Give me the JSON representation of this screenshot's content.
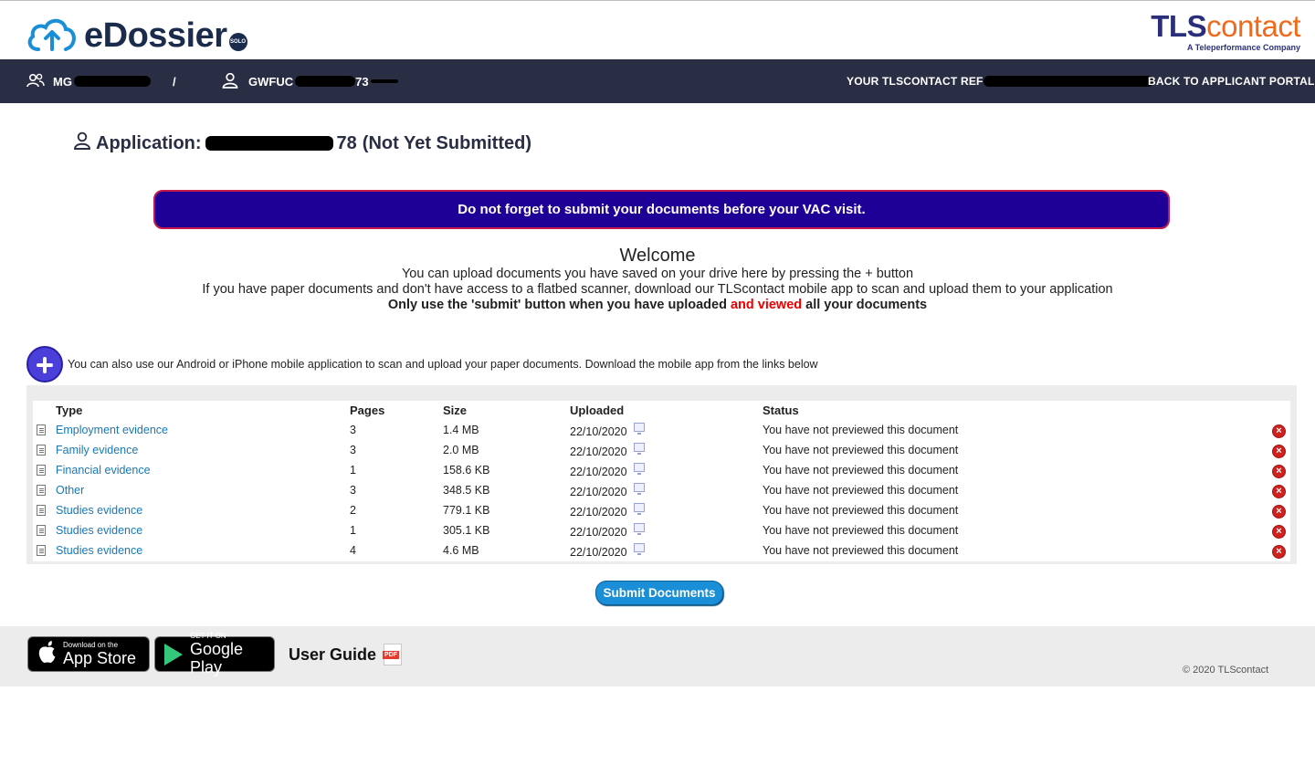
{
  "header": {
    "brand": "eDossier",
    "brand_badge": "SOLO",
    "partner_logo_main_a": "TLS",
    "partner_logo_main_b": "contact",
    "partner_logo_sub": "A Teleperformance Company"
  },
  "navbar": {
    "group_user_prefix": "MG",
    "separator": "/",
    "applicant_prefix": "GWFUC",
    "applicant_suffix": "73",
    "reference_prefix": "YOUR TLSCONTACT REF",
    "back_link": "BACK TO APPLICANT PORTAL"
  },
  "application": {
    "label": "Application:",
    "id_suffix": "78",
    "status": "(Not Yet Submitted)"
  },
  "banner": {
    "text": "Do not forget to submit your documents before your VAC visit."
  },
  "welcome": {
    "title": "Welcome",
    "line1": "You can upload documents you have saved on your drive here by pressing the + button",
    "line2": "If you have paper documents and don't have access to a flatbed scanner, download our TLScontact mobile app to scan and upload them to your application",
    "line3_a": "Only use the 'submit' button when you have uploaded ",
    "line3_red": "and viewed",
    "line3_b": " all your documents"
  },
  "add_section": {
    "text": "You can also use our Android or iPhone mobile application to scan and upload your paper documents. Download the mobile app from the links below"
  },
  "table": {
    "headers": {
      "type": "Type",
      "pages": "Pages",
      "size": "Size",
      "uploaded": "Uploaded",
      "status": "Status"
    },
    "rows": [
      {
        "type": "Employment evidence",
        "pages": "3",
        "size": "1.4 MB",
        "uploaded": "22/10/2020",
        "status": "You have not previewed this document"
      },
      {
        "type": "Family evidence",
        "pages": "3",
        "size": "2.0 MB",
        "uploaded": "22/10/2020",
        "status": "You have not previewed this document"
      },
      {
        "type": "Financial evidence",
        "pages": "1",
        "size": "158.6 KB",
        "uploaded": "22/10/2020",
        "status": "You have not previewed this document"
      },
      {
        "type": "Other",
        "pages": "3",
        "size": "348.5 KB",
        "uploaded": "22/10/2020",
        "status": "You have not previewed this document"
      },
      {
        "type": "Studies evidence",
        "pages": "2",
        "size": "779.1 KB",
        "uploaded": "22/10/2020",
        "status": "You have not previewed this document"
      },
      {
        "type": "Studies evidence",
        "pages": "1",
        "size": "305.1 KB",
        "uploaded": "22/10/2020",
        "status": "You have not previewed this document"
      },
      {
        "type": "Studies evidence",
        "pages": "4",
        "size": "4.6 MB",
        "uploaded": "22/10/2020",
        "status": "You have not previewed this document"
      }
    ]
  },
  "submit": {
    "label": "Submit Documents"
  },
  "footer": {
    "appstore_small": "Download on the",
    "appstore_big": "App Store",
    "googleplay_small": "GET IT ON",
    "googleplay_big": "Google Play",
    "user_guide": "User Guide",
    "pdf_label": "PDF",
    "copyright": "© 2020 TLScontact"
  },
  "colors": {
    "navbar": "#2a2e45",
    "banner": "#1f0096",
    "banner_border": "#c4184a",
    "link": "#1a78b4",
    "submit": "#1a8fd8",
    "highlight_red": "#e00000"
  },
  "icons": [
    "cloud-upload-icon",
    "group-user-icon",
    "user-icon",
    "document-icon",
    "monitor-icon",
    "delete-icon",
    "plus-icon",
    "apple-icon",
    "google-play-icon",
    "pdf-icon"
  ]
}
